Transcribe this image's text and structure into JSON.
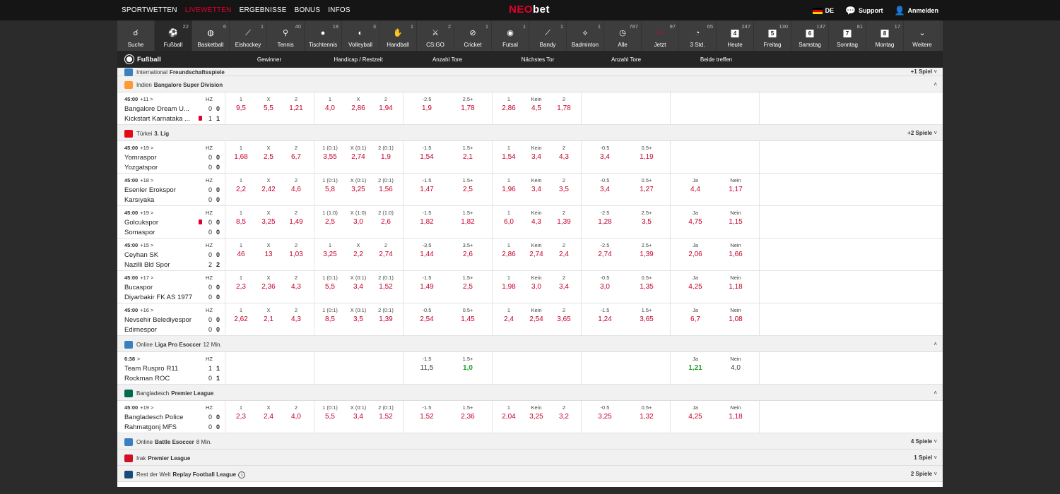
{
  "topnav": [
    "SPORTWETTEN",
    "LIVEWETTEN",
    "ERGEBNISSE",
    "BONUS",
    "INFOS"
  ],
  "logo": {
    "a": "NEO",
    "b": "bet"
  },
  "topright": {
    "lang": "DE",
    "support": "Support",
    "login": "Anmelden"
  },
  "sports": [
    {
      "label": "Suche",
      "count": "",
      "icon": "☌"
    },
    {
      "label": "Fußball",
      "count": "22",
      "icon": "⚽"
    },
    {
      "label": "Basketball",
      "count": "6",
      "icon": "◍"
    },
    {
      "label": "Eishockey",
      "count": "1",
      "icon": "⟋"
    },
    {
      "label": "Tennis",
      "count": "40",
      "icon": "⚲"
    },
    {
      "label": "Tischtennis",
      "count": "18",
      "icon": "●"
    },
    {
      "label": "Volleyball",
      "count": "3",
      "icon": "◐"
    },
    {
      "label": "Handball",
      "count": "1",
      "icon": "✋"
    },
    {
      "label": "CS:GO",
      "count": "2",
      "icon": "⚔"
    },
    {
      "label": "Cricket",
      "count": "1",
      "icon": "⊘"
    },
    {
      "label": "Futsal",
      "count": "1",
      "icon": "◉"
    },
    {
      "label": "Bandy",
      "count": "1",
      "icon": "⟋"
    },
    {
      "label": "Badminton",
      "count": "1",
      "icon": "⟡"
    },
    {
      "label": "Alle",
      "count": "787",
      "icon": "◷"
    },
    {
      "label": "Jetzt",
      "count": "97",
      "icon": "〰"
    },
    {
      "label": "3 Std.",
      "count": "65",
      "icon": "◔"
    },
    {
      "label": "Heute",
      "count": "247",
      "icon": "4"
    },
    {
      "label": "Freitag",
      "count": "130",
      "icon": "5"
    },
    {
      "label": "Samstag",
      "count": "137",
      "icon": "6"
    },
    {
      "label": "Sonntag",
      "count": "81",
      "icon": "7"
    },
    {
      "label": "Montag",
      "count": "17",
      "icon": "8"
    },
    {
      "label": "Weitere",
      "count": "",
      "icon": "⌄"
    }
  ],
  "header": {
    "sport": "Fußball",
    "cols": [
      "Gewinner",
      "Handicap / Restzeit",
      "Anzahl Tore",
      "Nächstes Tor",
      "Anzahl Tore",
      "Beide treffen"
    ]
  },
  "leagues": [
    {
      "country": "International",
      "name": "Freundschaftsspiele",
      "extra": "",
      "right": "+1 Spiel",
      "flag": "#3a80c0",
      "matches": []
    },
    {
      "country": "Indien",
      "name": "Bangalore Super Division",
      "extra": "",
      "right": "",
      "flag": "#ff9933",
      "matches": [
        {
          "time": "45:00",
          "plus": "+11 >",
          "t1": "Bangalore Dream U...",
          "t2": "Kickstart Karnataka ...",
          "s1": [
            "0",
            "0"
          ],
          "s2": [
            "1",
            "1"
          ],
          "red": 2,
          "g": [
            [
              "1",
              "9,5"
            ],
            [
              "X",
              "5,5"
            ],
            [
              "2",
              "1,21"
            ],
            [
              "1",
              "4,0"
            ],
            [
              "X",
              "2,86"
            ],
            [
              "2",
              "1,94"
            ],
            [
              "-2.5",
              "1,9"
            ],
            [
              "2.5+",
              "1,78"
            ],
            [
              "1",
              "2,86"
            ],
            [
              "Kein",
              "4,5"
            ],
            [
              "2",
              "1,78"
            ],
            [],
            [],
            [],
            []
          ]
        }
      ]
    },
    {
      "country": "Türkei",
      "name": "3. Lig",
      "extra": "",
      "right": "+2 Spiele",
      "flag": "#e30a17",
      "matches": [
        {
          "time": "45:00",
          "plus": "+19 >",
          "t1": "Yomraspor",
          "t2": "Yozgatspor",
          "s1": [
            "0",
            "0"
          ],
          "s2": [
            "0",
            "0"
          ],
          "red": 0,
          "g": [
            [
              "1",
              "1,68"
            ],
            [
              "X",
              "2,5"
            ],
            [
              "2",
              "6,7"
            ],
            [
              "1 (0:1)",
              "3,55"
            ],
            [
              "X (0:1)",
              "2,74"
            ],
            [
              "2 (0:1)",
              "1,9"
            ],
            [
              "-1.5",
              "1,54"
            ],
            [
              "1.5+",
              "2,1"
            ],
            [
              "1",
              "1,54"
            ],
            [
              "Kein",
              "3,4"
            ],
            [
              "2",
              "4,3"
            ],
            [
              "-0.5",
              "3,4"
            ],
            [
              "0.5+",
              "1,19"
            ],
            [],
            []
          ]
        },
        {
          "time": "45:00",
          "plus": "+18 >",
          "t1": "Esenler Erokspor",
          "t2": "Karsıyaka",
          "s1": [
            "0",
            "0"
          ],
          "s2": [
            "0",
            "0"
          ],
          "red": 0,
          "g": [
            [
              "1",
              "2,2"
            ],
            [
              "X",
              "2,42"
            ],
            [
              "2",
              "4,6"
            ],
            [
              "1 (0:1)",
              "5,8"
            ],
            [
              "X (0:1)",
              "3,25"
            ],
            [
              "2 (0:1)",
              "1,56"
            ],
            [
              "-1.5",
              "1,47"
            ],
            [
              "1.5+",
              "2,5"
            ],
            [
              "1",
              "1,96"
            ],
            [
              "Kein",
              "3,4"
            ],
            [
              "2",
              "3,5"
            ],
            [
              "-0.5",
              "3,4"
            ],
            [
              "0.5+",
              "1,27"
            ],
            [
              "Ja",
              "4,4"
            ],
            [
              "Nein",
              "1,17"
            ]
          ]
        },
        {
          "time": "45:00",
          "plus": "+19 >",
          "t1": "Golcukspor",
          "t2": "Somaspor",
          "s1": [
            "0",
            "0"
          ],
          "s2": [
            "0",
            "0"
          ],
          "red": 1,
          "g": [
            [
              "1",
              "8,5"
            ],
            [
              "X",
              "3,25"
            ],
            [
              "2",
              "1,49"
            ],
            [
              "1 (1:0)",
              "2,5"
            ],
            [
              "X (1:0)",
              "3,0"
            ],
            [
              "2 (1:0)",
              "2,6"
            ],
            [
              "-1.5",
              "1,82"
            ],
            [
              "1.5+",
              "1,82"
            ],
            [
              "1",
              "6,0"
            ],
            [
              "Kein",
              "4,3"
            ],
            [
              "2",
              "1,39"
            ],
            [
              "-2.5",
              "1,28"
            ],
            [
              "2.5+",
              "3,5"
            ],
            [
              "Ja",
              "4,75"
            ],
            [
              "Nein",
              "1,15"
            ]
          ]
        },
        {
          "time": "45:00",
          "plus": "+15 >",
          "t1": "Ceyhan SK",
          "t2": "Nazilli Bld Spor",
          "s1": [
            "0",
            "0"
          ],
          "s2": [
            "2",
            "2"
          ],
          "red": 0,
          "g": [
            [
              "1",
              "46"
            ],
            [
              "X",
              "13"
            ],
            [
              "2",
              "1,03"
            ],
            [
              "1",
              "3,25"
            ],
            [
              "X",
              "2,2"
            ],
            [
              "2",
              "2,74"
            ],
            [
              "-3.5",
              "1,44"
            ],
            [
              "3.5+",
              "2,6"
            ],
            [
              "1",
              "2,86"
            ],
            [
              "Kein",
              "2,74"
            ],
            [
              "2",
              "2,4"
            ],
            [
              "-2.5",
              "2,74"
            ],
            [
              "2.5+",
              "1,39"
            ],
            [
              "Ja",
              "2,06"
            ],
            [
              "Nein",
              "1,66"
            ]
          ]
        },
        {
          "time": "45:00",
          "plus": "+17 >",
          "t1": "Bucaspor",
          "t2": "Diyarbakir FK AS 1977",
          "s1": [
            "0",
            "0"
          ],
          "s2": [
            "0",
            "0"
          ],
          "red": 0,
          "g": [
            [
              "1",
              "2,3"
            ],
            [
              "X",
              "2,36"
            ],
            [
              "2",
              "4,3"
            ],
            [
              "1 (0:1)",
              "5,5"
            ],
            [
              "X (0:1)",
              "3,4"
            ],
            [
              "2 (0:1)",
              "1,52"
            ],
            [
              "-1.5",
              "1,49"
            ],
            [
              "1.5+",
              "2,5"
            ],
            [
              "1",
              "1,98"
            ],
            [
              "Kein",
              "3,0"
            ],
            [
              "2",
              "3,4"
            ],
            [
              "-0.5",
              "3,0"
            ],
            [
              "0.5+",
              "1,35"
            ],
            [
              "Ja",
              "4,25"
            ],
            [
              "Nein",
              "1,18"
            ]
          ]
        },
        {
          "time": "45:00",
          "plus": "+16 >",
          "t1": "Nevsehir Belediyespor",
          "t2": "Edirnespor",
          "s1": [
            "0",
            "0"
          ],
          "s2": [
            "0",
            "0"
          ],
          "red": 0,
          "g": [
            [
              "1",
              "2,62"
            ],
            [
              "X",
              "2,1"
            ],
            [
              "2",
              "4,3"
            ],
            [
              "1 (0:1)",
              "8,5"
            ],
            [
              "X (0:1)",
              "3,5"
            ],
            [
              "2 (0:1)",
              "1,39"
            ],
            [
              "-0.5",
              "2,54"
            ],
            [
              "0.5+",
              "1,45"
            ],
            [
              "1",
              "2,4"
            ],
            [
              "Kein",
              "2,54"
            ],
            [
              "2",
              "3,65"
            ],
            [
              "-1.5",
              "1,24"
            ],
            [
              "1.5+",
              "3,65"
            ],
            [
              "Ja",
              "6,7"
            ],
            [
              "Nein",
              "1,08"
            ]
          ]
        }
      ]
    },
    {
      "country": "Online",
      "name": "Liga Pro Esoccer",
      "extra": "12 Min.",
      "right": "",
      "flag": "#3a80c0",
      "matches": [
        {
          "time": "6:38",
          "plus": ">",
          "t1": "Team Ruspro",
          "t1b": "R11",
          "t2": "Rockman",
          "t2b": "ROC",
          "s1": [
            "1",
            "1"
          ],
          "s2": [
            "0",
            "1"
          ],
          "red": 0,
          "g": [
            [],
            [],
            [],
            [],
            [],
            [],
            [
              "-1.5",
              "11,5",
              "k"
            ],
            [
              "1.5+",
              "1,0",
              "g"
            ],
            [],
            [],
            [],
            [],
            [],
            [
              "Ja",
              "1,21",
              "g"
            ],
            [
              "Nein",
              "4,0",
              "k"
            ]
          ]
        }
      ]
    },
    {
      "country": "Bangladesch",
      "name": "Premier League",
      "extra": "",
      "right": "",
      "flag": "#006a4e",
      "matches": [
        {
          "time": "45:00",
          "plus": "+19 >",
          "t1": "Bangladesch Police",
          "t2": "Rahmatgonj MFS",
          "s1": [
            "0",
            "0"
          ],
          "s2": [
            "0",
            "0"
          ],
          "red": 0,
          "g": [
            [
              "1",
              "2,3"
            ],
            [
              "X",
              "2,4"
            ],
            [
              "2",
              "4,0"
            ],
            [
              "1 (0:1)",
              "5,5"
            ],
            [
              "X (0:1)",
              "3,4"
            ],
            [
              "2 (0:1)",
              "1,52"
            ],
            [
              "-1.5",
              "1,52"
            ],
            [
              "1.5+",
              "2,36"
            ],
            [
              "1",
              "2,04"
            ],
            [
              "Kein",
              "3,25"
            ],
            [
              "2",
              "3,2"
            ],
            [
              "-0.5",
              "3,25"
            ],
            [
              "0.5+",
              "1,32"
            ],
            [
              "Ja",
              "4,25"
            ],
            [
              "Nein",
              "1,18"
            ]
          ]
        }
      ]
    },
    {
      "country": "Online",
      "name": "Battle Esoccer",
      "extra": "8 Min.",
      "right": "4 Spiele",
      "flag": "#3a80c0",
      "matches": []
    },
    {
      "country": "Irak",
      "name": "Premier League",
      "extra": "",
      "right": "1 Spiel",
      "flag": "#ce1126",
      "matches": []
    },
    {
      "country": "Rest der Welt",
      "name": "Replay Football League",
      "extra": "",
      "right": "2 Spiele",
      "flag": "#1a4a7a",
      "matches": []
    }
  ],
  "colors": {
    "accent": "#e2002b",
    "odds": "#c8002a",
    "green": "#21a025"
  },
  "hz_label": "HZ"
}
